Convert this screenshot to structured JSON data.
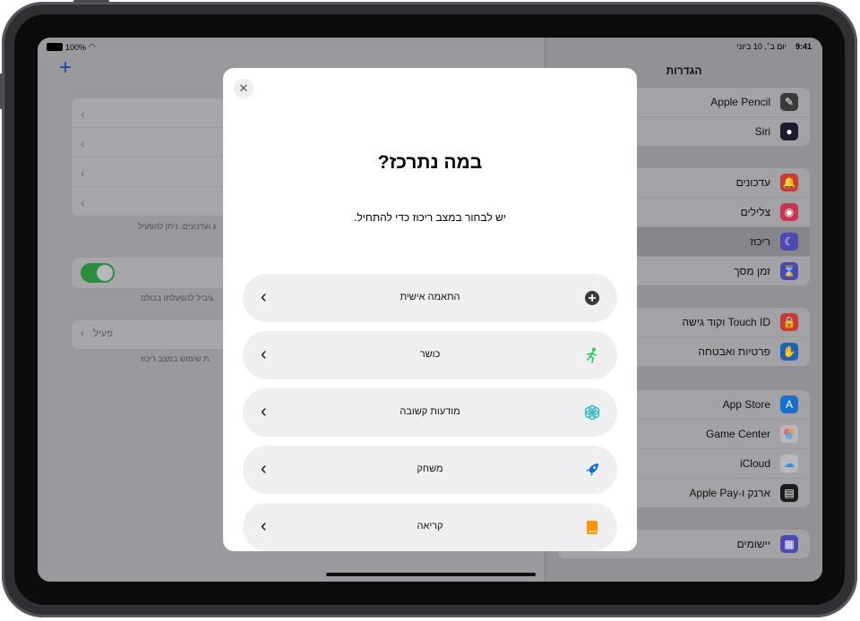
{
  "status_bar": {
    "time": "9:41",
    "date": "יום ב׳, 10 ביוני",
    "battery": "100%"
  },
  "settings": {
    "title": "הגדרות",
    "group1": [
      {
        "label": "Apple Pencil",
        "icon": "pencil-icon",
        "color": "#3a3a3c"
      },
      {
        "label": "Siri",
        "icon": "siri-icon",
        "color": "#1c1c2e"
      }
    ],
    "group2": [
      {
        "label": "עדכונים",
        "icon": "bell-icon",
        "color": "#ff3b30"
      },
      {
        "label": "צלילים",
        "icon": "speaker-icon",
        "color": "#ff2d55"
      },
      {
        "label": "ריכוז",
        "icon": "moon-icon",
        "color": "#5856d6",
        "selected": true
      },
      {
        "label": "זמן מסך",
        "icon": "hourglass-icon",
        "color": "#5856d6"
      }
    ],
    "group3": [
      {
        "label": "Touch ID וקוד גישה",
        "icon": "lock-icon",
        "color": "#ff3b30"
      },
      {
        "label": "פרטיות ואבטחה",
        "icon": "hand-icon",
        "color": "#007aff"
      }
    ],
    "group4": [
      {
        "label": "App Store",
        "icon": "appstore-icon",
        "color": "#0a84ff"
      },
      {
        "label": "Game Center",
        "icon": "gamecenter-icon",
        "color": "#ffffff"
      },
      {
        "label": "iCloud",
        "icon": "cloud-icon",
        "color": "#ffffff"
      },
      {
        "label": "ארנק ו-Apple Pay",
        "icon": "wallet-icon",
        "color": "#1c1c1e"
      }
    ],
    "group5": [
      {
        "label": "יישומים",
        "icon": "apps-icon",
        "color": "#5856d6"
      }
    ]
  },
  "focus_pane": {
    "footer1": "ג ועדכונים. ניתן להפעיל",
    "footer2": "גיביל להפעלתו בכולם.",
    "active_label": "פעיל",
    "footer3": "ת שימוש במצב ריכוז."
  },
  "modal": {
    "close_label": "✕",
    "title": "במה נתרכז?",
    "subtitle": "יש לבחור במצב ריכוז כדי להתחיל.",
    "options": [
      {
        "label": "התאמה אישית",
        "icon": "plus-circle-icon",
        "color": "#3a3a3c"
      },
      {
        "label": "כושר",
        "icon": "running-icon",
        "color": "#34c759"
      },
      {
        "label": "מודעות קשובה",
        "icon": "mindfulness-icon",
        "color": "#30c6c6"
      },
      {
        "label": "משחק",
        "icon": "rocket-icon",
        "color": "#0a84ff"
      },
      {
        "label": "קריאה",
        "icon": "book-icon",
        "color": "#ff9500"
      }
    ]
  }
}
